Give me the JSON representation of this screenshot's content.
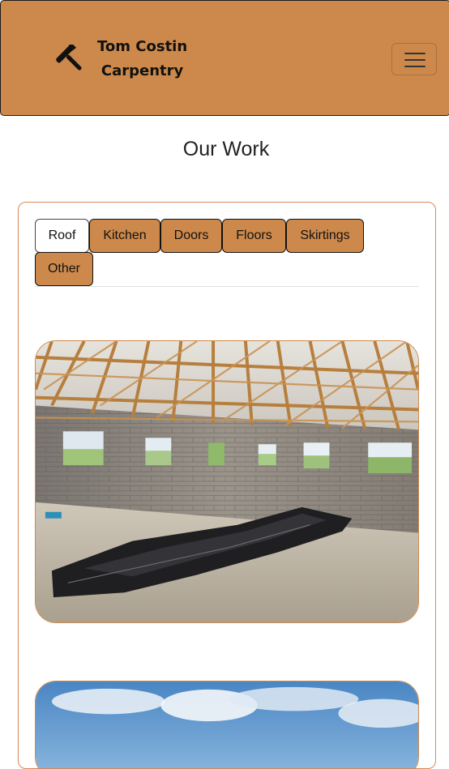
{
  "header": {
    "brand_line1": "Tom Costin",
    "brand_line2": "Carpentry",
    "brand_icon": "hammer-icon",
    "menu_icon": "hamburger-menu-icon",
    "background_color": "#cd894b"
  },
  "main": {
    "page_title": "Our Work",
    "tabs": [
      {
        "label": "Roof",
        "active": true
      },
      {
        "label": "Kitchen",
        "active": false
      },
      {
        "label": "Doors",
        "active": false
      },
      {
        "label": "Floors",
        "active": false
      },
      {
        "label": "Skirtings",
        "active": false
      },
      {
        "label": "Other",
        "active": false
      }
    ],
    "photos": [
      {
        "subject": "roof-trusses-interior-photo"
      },
      {
        "subject": "sky-photo"
      }
    ]
  },
  "colors": {
    "accent": "#cd894b",
    "card_border": "#d5895a"
  }
}
